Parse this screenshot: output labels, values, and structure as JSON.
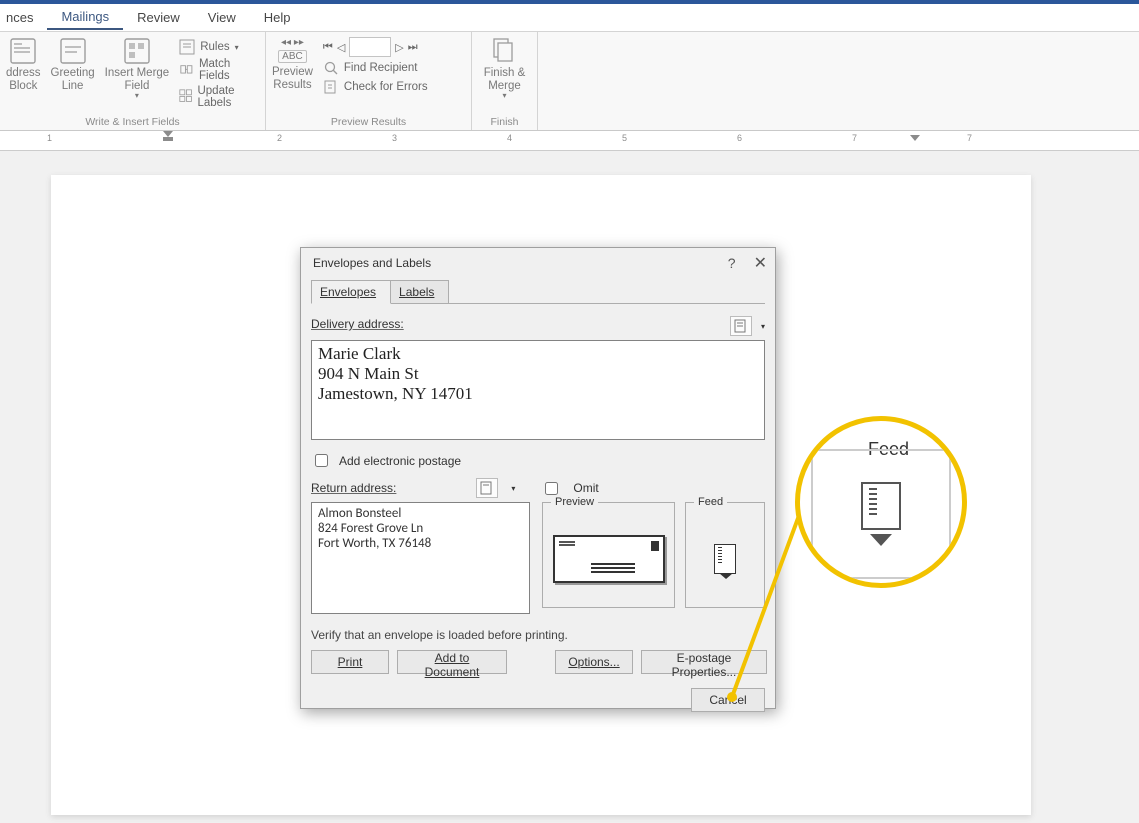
{
  "tabs": {
    "t0": "nces",
    "t1": "Mailings",
    "t2": "Review",
    "t3": "View",
    "t4": "Help"
  },
  "ribbon": {
    "address_block": "ddress\nBlock",
    "greeting": "Greeting\nLine",
    "insert_merge": "Insert Merge\nField",
    "rules": "Rules",
    "match_fields": "Match Fields",
    "update_labels": "Update Labels",
    "group1": "Write & Insert Fields",
    "preview_results": "Preview\nResults",
    "find_recipient": "Find Recipient",
    "check_errors": "Check for Errors",
    "group2": "Preview Results",
    "finish_merge": "Finish &\nMerge",
    "group3": "Finish"
  },
  "ruler": {
    "n1": "1",
    "n2": "2",
    "n3": "3",
    "n4": "4",
    "n5": "5",
    "n6": "6",
    "n7": "7"
  },
  "dialog": {
    "title": "Envelopes and Labels",
    "tab_envelopes": "Envelopes",
    "tab_labels": "Labels",
    "delivery_label": "Delivery address:",
    "delivery_value": "Marie Clark\n904 N Main St\nJamestown, NY 14701",
    "postage": "Add electronic postage",
    "return_label": "Return address:",
    "omit": "Omit",
    "return_value": "Almon Bonsteel\n824 Forest Grove Ln\nFort Worth, TX 76148",
    "preview": "Preview",
    "feed": "Feed",
    "verify": "Verify that an envelope is loaded before printing.",
    "btn_print": "Print",
    "btn_add": "Add to Document",
    "btn_options": "Options...",
    "btn_epostage": "E-postage Properties...",
    "btn_cancel": "Cancel"
  },
  "callout": {
    "feed": "Feed"
  }
}
